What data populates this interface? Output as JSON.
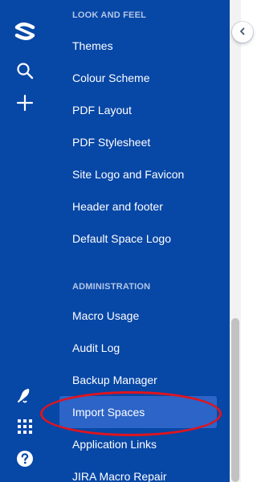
{
  "global_nav": {
    "icons": [
      "confluence-logo-icon",
      "search-icon",
      "create-icon",
      "notifications-icon",
      "app-switcher-icon",
      "help-icon"
    ]
  },
  "sidebar": {
    "sections": [
      {
        "heading": "LOOK AND FEEL",
        "items": [
          {
            "label": "Themes"
          },
          {
            "label": "Colour Scheme"
          },
          {
            "label": "PDF Layout"
          },
          {
            "label": "PDF Stylesheet"
          },
          {
            "label": "Site Logo and Favicon"
          },
          {
            "label": "Header and footer"
          },
          {
            "label": "Default Space Logo"
          }
        ]
      },
      {
        "heading": "ADMINISTRATION",
        "items": [
          {
            "label": "Macro Usage"
          },
          {
            "label": "Audit Log"
          },
          {
            "label": "Backup Manager"
          },
          {
            "label": "Import Spaces",
            "selected": true
          },
          {
            "label": "Application Links"
          },
          {
            "label": "JIRA Macro Repair"
          }
        ]
      }
    ]
  },
  "colors": {
    "nav_background": "#0747a6",
    "selected_item": "#2c64c7",
    "annotation_ring": "#e0141e"
  }
}
